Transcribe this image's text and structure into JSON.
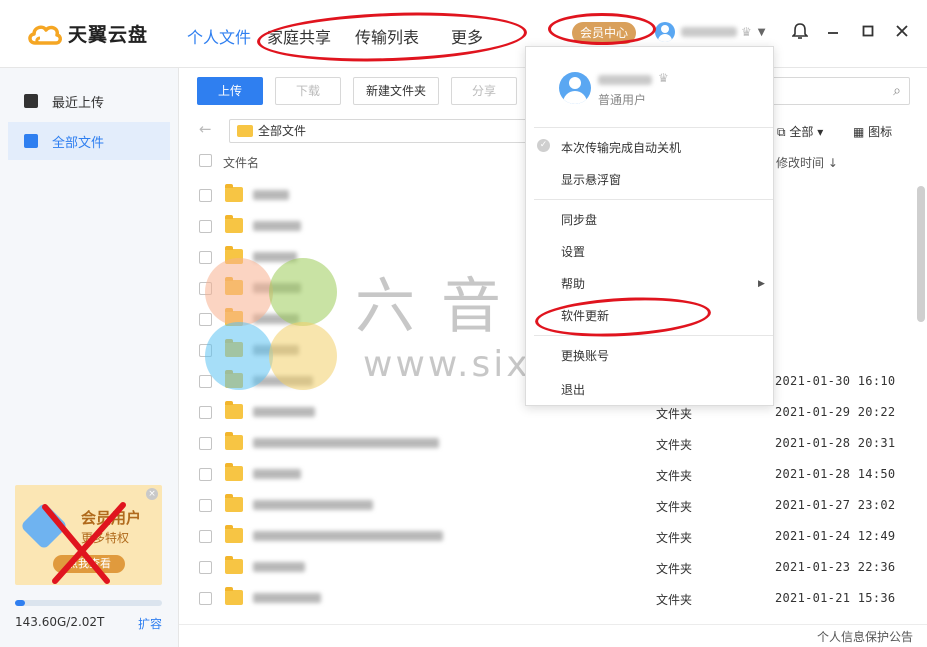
{
  "app": {
    "name": "天翼云盘"
  },
  "nav": {
    "items": [
      "个人文件",
      "家庭共享",
      "传输列表",
      "更多"
    ]
  },
  "header": {
    "vip_center": "会员中心",
    "user_name_hidden": "(blurred)"
  },
  "icons": {
    "logo": "cloud-logo-icon",
    "user": "avatar-icon",
    "crown": "crown-icon",
    "dropdown": "chevron-down-icon",
    "notification": "bell-icon",
    "minimize": "minimize-icon",
    "maximize": "maximize-icon",
    "close": "close-icon",
    "search": "search-icon",
    "back": "back-arrow-icon",
    "sort": "sort-icon",
    "view": "grid-icon"
  },
  "colors": {
    "accent": "#2f7ff0",
    "vip": "#d9a05b",
    "annotation": "#e0141e",
    "folder": "#f7c544"
  },
  "sidebar": {
    "items": [
      {
        "label": "最近上传"
      },
      {
        "label": "全部文件"
      }
    ],
    "promo": {
      "title": "会员用户",
      "subtitle": "更多特权",
      "button": "点我查看"
    },
    "storage": {
      "text": "143.60G/2.02T",
      "expand": "扩容",
      "used_fraction": 0.07
    }
  },
  "toolbar": {
    "upload": "上传",
    "download": "下载",
    "new_folder": "新建文件夹",
    "share": "分享"
  },
  "path": {
    "current": "全部文件"
  },
  "view": {
    "sort_label": "全部",
    "view_label": "图标"
  },
  "columns": {
    "name": "文件名",
    "modified": "修改时间 ↓"
  },
  "files": [
    {
      "type": "",
      "time": ""
    },
    {
      "type": "",
      "time": ""
    },
    {
      "type": "",
      "time": ""
    },
    {
      "type": "",
      "time": ""
    },
    {
      "type": "",
      "time": ""
    },
    {
      "type": "",
      "time": ""
    },
    {
      "type": "",
      "time": "2021-01-30 16:10"
    },
    {
      "type": "文件夹",
      "time": "2021-01-29 20:22"
    },
    {
      "type": "文件夹",
      "time": "2021-01-28 20:31"
    },
    {
      "type": "文件夹",
      "time": "2021-01-28 14:50"
    },
    {
      "type": "文件夹",
      "time": "2021-01-27 23:02"
    },
    {
      "type": "文件夹",
      "time": "2021-01-24 12:49"
    },
    {
      "type": "文件夹",
      "time": "2021-01-23 22:36"
    },
    {
      "type": "文件夹",
      "time": "2021-01-21 15:36"
    }
  ],
  "menu": {
    "user_type": "普通用户",
    "auto_shutdown": "本次传输完成自动关机",
    "show_float": "显示悬浮窗",
    "sync_disk": "同步盘",
    "settings": "设置",
    "help": "帮助",
    "software_update": "软件更新",
    "switch_account": "更换账号",
    "logout": "退出"
  },
  "watermark": {
    "title": "六音软件",
    "url": "www.sixyin.com"
  },
  "footer": {
    "notice": "个人信息保护公告"
  }
}
